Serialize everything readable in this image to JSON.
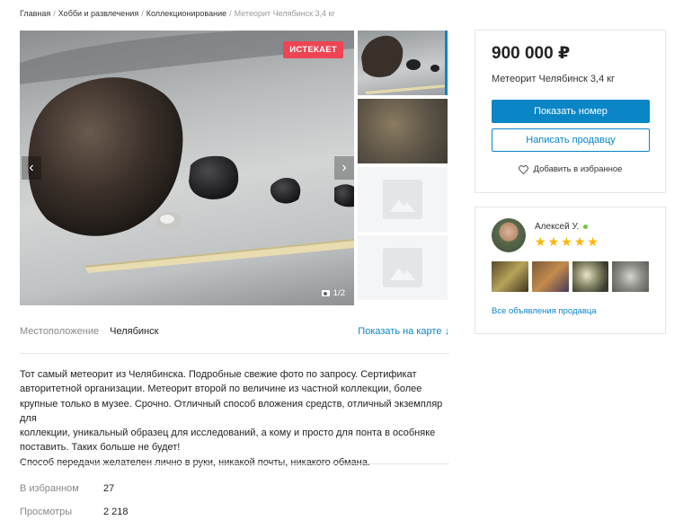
{
  "breadcrumb": {
    "items": [
      "Главная",
      "Хобби и развлечения",
      "Коллекционирование"
    ],
    "current": "Метеорит Челябинск 3,4 кг",
    "separator": "/"
  },
  "gallery": {
    "badge": "ИСТЕКАЕТ",
    "counter": "1/2",
    "prev_arrow": "‹",
    "next_arrow": "›"
  },
  "location": {
    "label": "Местоположение",
    "value": "Челябинск",
    "map_link": "Показать на карте ↓"
  },
  "description": {
    "lines": [
      "Тот самый метеорит из Челябинска. Подробные свежие фото по запросу. Сертификат",
      "авторитетной организации. Метеорит второй по величине из частной коллекции, более",
      "крупные только в музее. Срочно. Отличный способ вложения средств, отличный экземпляр для",
      "коллекции, уникальный образец для исследований, а кому и просто для понта в особняке",
      "поставить. Таких больше не будет!",
      "Способ передачи желателен лично в руки, никакой почты, никакого обмана."
    ]
  },
  "stats": {
    "favorites_label": "В избранном",
    "favorites_value": "27",
    "views_label": "Просмотры",
    "views_value": "2 218"
  },
  "price_card": {
    "price": "900 000 ₽",
    "title": "Метеорит Челябинск 3,4 кг",
    "show_phone": "Показать номер",
    "write_seller": "Написать продавцу",
    "add_favorite": "Добавить в избранное"
  },
  "seller": {
    "name": "Алексей У.",
    "rating_stars": 5,
    "all_ads_link": "Все объявления продавца"
  },
  "colors": {
    "accent": "#0a86c7",
    "badge": "#ef4453",
    "star": "#ffb400",
    "online": "#6ec744"
  },
  "icons": [
    "chevron-left-icon",
    "chevron-right-icon",
    "camera-icon",
    "heart-icon",
    "image-placeholder-icon",
    "star-icon",
    "online-dot-icon"
  ]
}
